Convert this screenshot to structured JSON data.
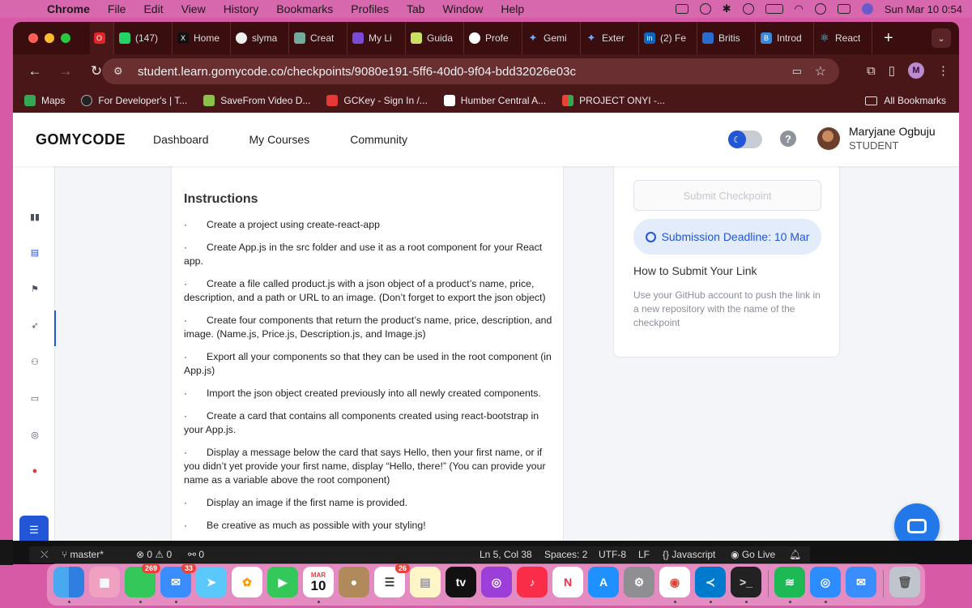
{
  "menubar": {
    "app": "Chrome",
    "items": [
      "File",
      "Edit",
      "View",
      "History",
      "Bookmarks",
      "Profiles",
      "Tab",
      "Window",
      "Help"
    ],
    "datetime": "Sun Mar 10  0:54"
  },
  "tabs": [
    {
      "label": "",
      "icon": "opera-icon"
    },
    {
      "label": "(147)",
      "icon": "whatsapp-icon"
    },
    {
      "label": "Home",
      "icon": "x-icon"
    },
    {
      "label": "slyma",
      "icon": "github-icon"
    },
    {
      "label": "Creat",
      "icon": "chatgpt-icon"
    },
    {
      "label": "My Li",
      "icon": "app-icon"
    },
    {
      "label": "Guida",
      "icon": "guide-icon"
    },
    {
      "label": "Profe",
      "icon": "google-icon"
    },
    {
      "label": "Gemi",
      "icon": "gemini-icon"
    },
    {
      "label": "Exter",
      "icon": "gemini-icon"
    },
    {
      "label": "(2) Fe",
      "icon": "linkedin-icon"
    },
    {
      "label": "Britis",
      "icon": "british-council-icon"
    },
    {
      "label": "Introd",
      "icon": "bootstrap-icon"
    },
    {
      "label": "React",
      "icon": "react-icon"
    }
  ],
  "address": {
    "url": "student.learn.gomycode.co/checkpoints/9080e191-5ff6-40d0-9f04-bdd32026e03c"
  },
  "profile_initial": "M",
  "bookmarks": [
    {
      "label": "Maps",
      "color": "#34a853"
    },
    {
      "label": "For Developer's | T...",
      "color": "#222222"
    },
    {
      "label": "SaveFrom Video D...",
      "color": "#8bc34a"
    },
    {
      "label": "GCKey - Sign In /...",
      "color": "#e53935"
    },
    {
      "label": "Humber Central A...",
      "color": "#ffffff"
    },
    {
      "label": "PROJECT ONYI -...",
      "color": "#f4b400"
    }
  ],
  "all_bookmarks": "All Bookmarks",
  "header": {
    "logo": "GOMYCODE",
    "nav": [
      "Dashboard",
      "My Courses",
      "Community"
    ],
    "user_name": "Maryjane Ogbuju",
    "user_role": "STUDENT",
    "help": "?",
    "moon": "☾"
  },
  "instructions": {
    "title": "Instructions",
    "bullet": "·",
    "items": [
      "Create a project using create-react-app",
      "Create App.js in the src folder and use it as a root component for your React app.",
      "Create a file called product.js with a json object of a product’s name, price, description, and a path or URL to an image. (Don’t forget to export the json object)",
      "Create four components that return the product’s name, price, description, and image. (Name.js, Price.js, Description.js, and Image.js)",
      "Export all your components so that they can be used in the root component (in App.js)",
      "Import the json object created previously into all newly created components.",
      "Create a card that contains all components created using react-bootstrap in your App.js.",
      "Display a message below the card that says Hello, then your first name, or if you didn’t yet provide your first name, display “Hello, there!” (You can provide your name as a variable above the root component)",
      "Display an image if the first name is provided.",
      "Be creative as much as possible with your styling!"
    ]
  },
  "submission": {
    "submit_label": "Submit Checkpoint",
    "deadline": "Submission Deadline: 10 Mar",
    "how_title": "How to Submit Your Link",
    "how_text": "Use your GitHub account to push the link in a new repository with the name of the checkpoint"
  },
  "statusbar": {
    "branch": "master*",
    "errors": "⊗ 0 ⚠ 0",
    "ports": "⚯ 0",
    "position": "Ln 5, Col 38",
    "spaces": "Spaces: 2",
    "encoding": "UTF-8",
    "eol": "LF",
    "language": "{} Javascript",
    "golive": "Go Live"
  },
  "dock": {
    "badges": {
      "messages": "269",
      "mail": "33",
      "reminders": "26"
    },
    "calendar_month": "MAR",
    "calendar_day": "10",
    "tv_label": "tv"
  }
}
